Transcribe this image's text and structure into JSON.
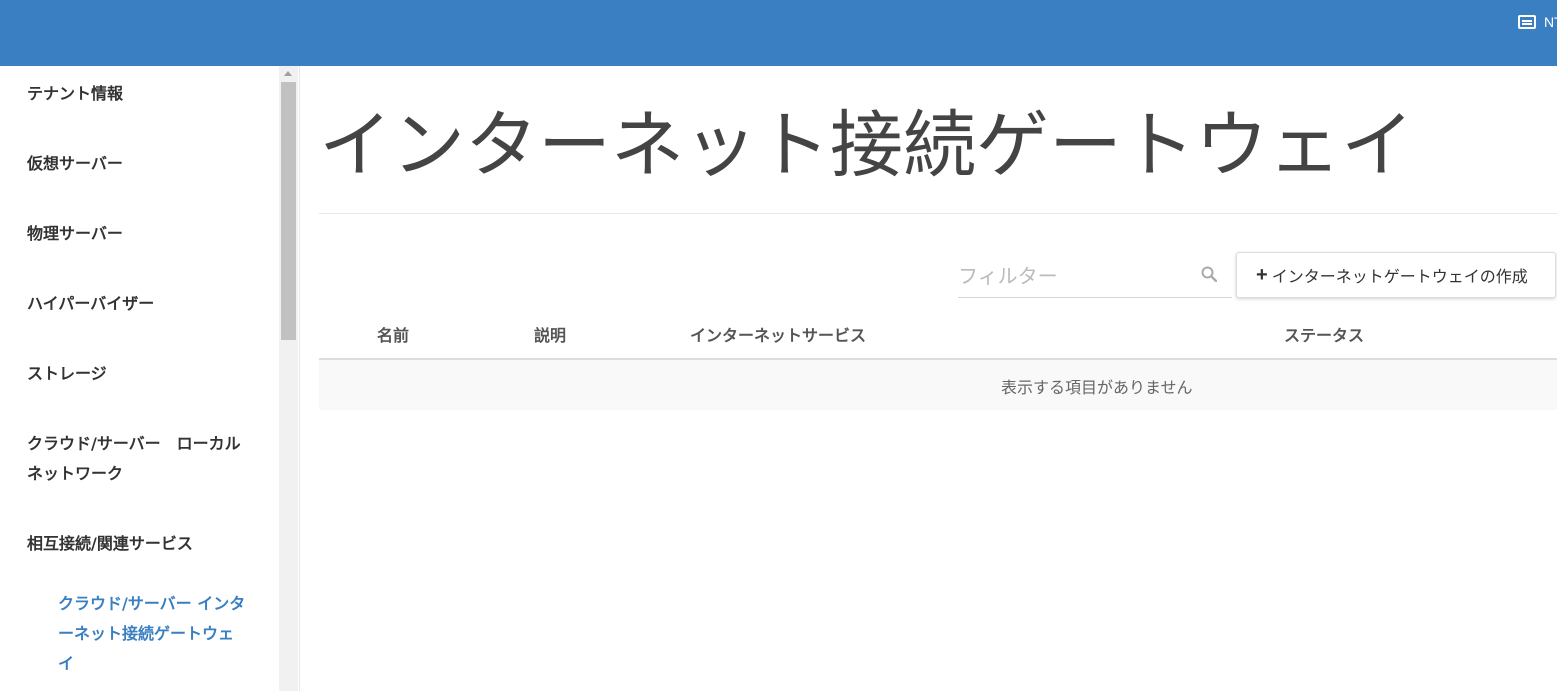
{
  "header": {
    "user_label": "NTT",
    "colors": {
      "bar": "#3a7fc2",
      "link": "#3a7fc2"
    },
    "menu_icon": "list-icon"
  },
  "sidebar": {
    "items": [
      {
        "label": "テナント情報"
      },
      {
        "label": "仮想サーバー"
      },
      {
        "label": "物理サーバー"
      },
      {
        "label": "ハイパーバイザー"
      },
      {
        "label": "ストレージ"
      },
      {
        "label_line1": "クラウド/サーバー　ローカル",
        "label_line2": "ネットワーク"
      },
      {
        "label": "相互接続/関連サービス"
      }
    ],
    "active_subitem": {
      "line1": "クラウド/サーバー インタ",
      "line2": "ーネット接続ゲートウェ",
      "line3": "イ"
    }
  },
  "main": {
    "title": "インターネット接続ゲートウェイ",
    "filter": {
      "placeholder": "フィルター"
    },
    "create_button": {
      "label": "インターネットゲートウェイの作成"
    },
    "table": {
      "columns": [
        "名前",
        "説明",
        "インターネットサービス",
        "ステータス"
      ],
      "empty_message": "表示する項目がありません"
    }
  }
}
